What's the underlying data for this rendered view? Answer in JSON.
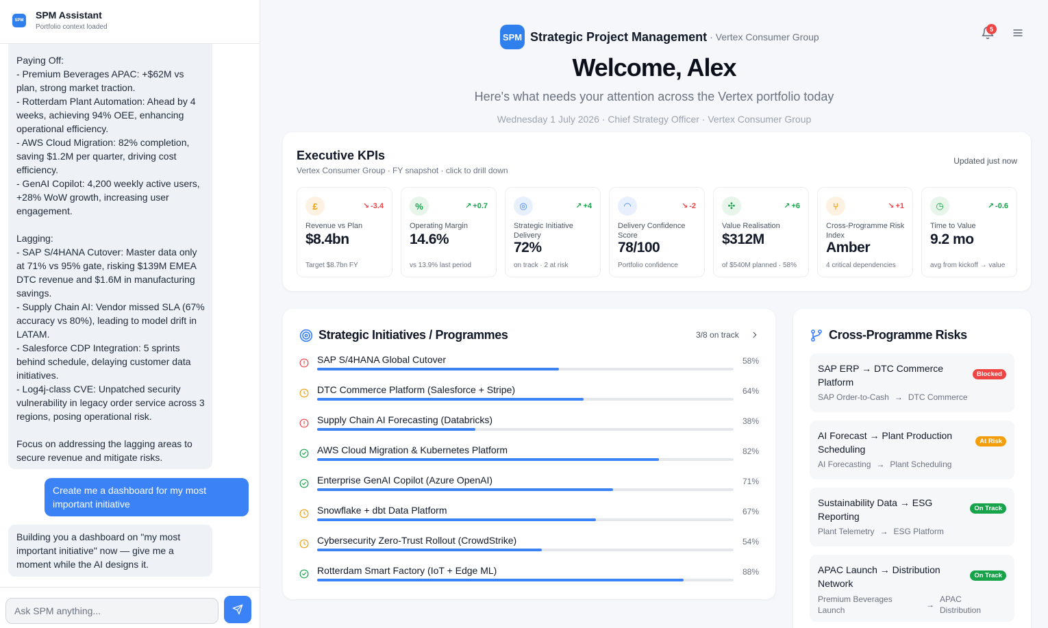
{
  "chat": {
    "title": "SPM Assistant",
    "subtitle": "Portfolio context loaded",
    "logo": "SPM",
    "messages": {
      "ai_summary": "Paying Off:\n- Premium Beverages APAC: +$62M vs plan, strong market traction.\n- Rotterdam Plant Automation: Ahead by 4 weeks, achieving 94% OEE, enhancing operational efficiency.\n- AWS Cloud Migration: 82% completion, saving $1.2M per quarter, driving cost efficiency.\n- GenAI Copilot: 4,200 weekly active users, +28% WoW growth, increasing user engagement.\n\nLagging:\n- SAP S/4HANA Cutover: Master data only at 71% vs 95% gate, risking $139M EMEA DTC revenue and $1.6M in manufacturing savings.\n- Supply Chain AI: Vendor missed SLA (67% accuracy vs 80%), leading to model drift in LATAM.\n- Salesforce CDP Integration: 5 sprints behind schedule, delaying customer data initiatives.\n- Log4j-class CVE: Unpatched security vulnerability in legacy order service across 3 regions, posing operational risk.\n\nFocus on addressing the lagging areas to secure revenue and mitigate risks.",
      "user_request": "Create me a dashboard for my most important initiative",
      "ai_building": "Building you a dashboard on \"my most important initiative\" now — give me a moment while the AI designs it."
    },
    "input_placeholder": "Ask SPM anything...",
    "send_icon": "send-icon"
  },
  "header": {
    "logo": "SPM",
    "app_name": "Strategic Project Management",
    "separator": "·",
    "org": "Vertex Consumer Group",
    "notification_count": "5",
    "welcome": "Welcome, Alex",
    "tagline": "Here's what needs your attention across the Vertex portfolio today",
    "dateline": "Wednesday 1 July 2026 · Chief Strategy Officer · Vertex Consumer Group"
  },
  "kpis": {
    "title": "Executive KPIs",
    "subtitle": "Vertex Consumer Group · FY snapshot · click to drill down",
    "updated": "Updated just now",
    "tiles": [
      {
        "icon": "pound-icon",
        "glyph": "£",
        "icon_color": "#f59e0b",
        "icon_bg": "#fdf1e2",
        "delta": "-3.4",
        "direction": "down",
        "label": "Revenue vs Plan",
        "value": "$8.4bn",
        "foot": "Target $8.7bn FY"
      },
      {
        "icon": "percent-icon",
        "glyph": "%",
        "icon_color": "#16a34a",
        "icon_bg": "#e7f5ea",
        "delta": "+0.7",
        "direction": "up",
        "label": "Operating Margin",
        "value": "14.6%",
        "foot": "vs 13.9% last period"
      },
      {
        "icon": "target-icon",
        "glyph": "◎",
        "icon_color": "#3b82f6",
        "icon_bg": "#e8effd",
        "delta": "+4",
        "direction": "up",
        "label": "Strategic Initiative Delivery",
        "value": "72%",
        "foot": "on track · 2 at risk"
      },
      {
        "icon": "gauge-icon",
        "glyph": "◠",
        "icon_color": "#3b82f6",
        "icon_bg": "#e8effd",
        "delta": "-2",
        "direction": "down",
        "label": "Delivery Confidence Score",
        "value": "78/100",
        "foot": "Portfolio confidence"
      },
      {
        "icon": "sparkle-icon",
        "glyph": "✣",
        "icon_color": "#16a34a",
        "icon_bg": "#e7f5ea",
        "delta": "+6",
        "direction": "up",
        "label": "Value Realisation",
        "value": "$312M",
        "foot": "of $540M planned · 58%"
      },
      {
        "icon": "branch-icon",
        "glyph": "⑂",
        "icon_color": "#f59e0b",
        "icon_bg": "#fdf1e2",
        "delta": "+1",
        "direction": "down",
        "label": "Cross-Programme Risk Index",
        "value": "Amber",
        "foot": "4 critical dependencies"
      },
      {
        "icon": "clock-icon",
        "glyph": "◷",
        "icon_color": "#16a34a",
        "icon_bg": "#e7f5ea",
        "delta": "-0.6",
        "direction": "up",
        "label": "Time to Value",
        "value": "9.2 mo",
        "foot": "avg from kickoff → value"
      }
    ]
  },
  "initiatives": {
    "title": "Strategic Initiatives / Programmes",
    "count": "3/8 on track",
    "rows": [
      {
        "name": "SAP S/4HANA Global Cutover",
        "pct": "58%",
        "progress": 0.58,
        "status": "at-risk",
        "status_color": "#ef4444"
      },
      {
        "name": "DTC Commerce Platform (Salesforce + Stripe)",
        "pct": "64%",
        "progress": 0.64,
        "status": "watch",
        "status_color": "#f59e0b"
      },
      {
        "name": "Supply Chain AI Forecasting (Databricks)",
        "pct": "38%",
        "progress": 0.38,
        "status": "at-risk",
        "status_color": "#ef4444"
      },
      {
        "name": "AWS Cloud Migration & Kubernetes Platform",
        "pct": "82%",
        "progress": 0.82,
        "status": "on-track",
        "status_color": "#16a34a"
      },
      {
        "name": "Enterprise GenAI Copilot (Azure OpenAI)",
        "pct": "71%",
        "progress": 0.71,
        "status": "on-track",
        "status_color": "#16a34a"
      },
      {
        "name": "Snowflake + dbt Data Platform",
        "pct": "67%",
        "progress": 0.67,
        "status": "watch",
        "status_color": "#f59e0b"
      },
      {
        "name": "Cybersecurity Zero-Trust Rollout (CrowdStrike)",
        "pct": "54%",
        "progress": 0.54,
        "status": "watch",
        "status_color": "#f59e0b"
      },
      {
        "name": "Rotterdam Smart Factory (IoT + Edge ML)",
        "pct": "88%",
        "progress": 0.88,
        "status": "on-track",
        "status_color": "#16a34a"
      }
    ]
  },
  "risks": {
    "title": "Cross-Programme Risks",
    "items": [
      {
        "name": "SAP ERP → DTC Commerce Platform",
        "badge": "Blocked",
        "badge_color": "#ef4444",
        "from": "SAP Order-to-Cash",
        "to": "DTC Commerce",
        "arrow": "→"
      },
      {
        "name": "AI Forecast → Plant Production Scheduling",
        "badge": "At Risk",
        "badge_color": "#f59e0b",
        "from": "AI Forecasting",
        "to": "Plant Scheduling",
        "arrow": "→"
      },
      {
        "name": "Sustainability Data → ESG Reporting",
        "badge": "On Track",
        "badge_color": "#16a34a",
        "from": "Plant Telemetry",
        "to": "ESG Platform",
        "arrow": "→"
      },
      {
        "name": "APAC Launch → Distribution Network",
        "badge": "On Track",
        "badge_color": "#16a34a",
        "from": "Premium Beverages Launch",
        "to": "APAC Distribution",
        "arrow": "→"
      }
    ]
  }
}
